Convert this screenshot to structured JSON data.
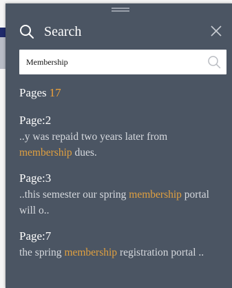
{
  "header": {
    "title": "Search"
  },
  "search": {
    "value": "Membership"
  },
  "pages": {
    "label": "Pages",
    "count": "17"
  },
  "results": [
    {
      "page": "Page:2",
      "before": "..y was repaid two years later from ",
      "match": "membership",
      "after": " dues."
    },
    {
      "page": "Page:3",
      "before": "..this semester our spring ",
      "match": "membership",
      "after": " portal will o.."
    },
    {
      "page": "Page:7",
      "before": "the spring ",
      "match": "membership",
      "after": " registration portal .."
    }
  ],
  "colors": {
    "panel": "#4b5563",
    "highlight": "#e0a040",
    "count": "#f0a33a"
  },
  "icons": [
    "drag-handle-icon",
    "search-icon",
    "close-icon"
  ]
}
